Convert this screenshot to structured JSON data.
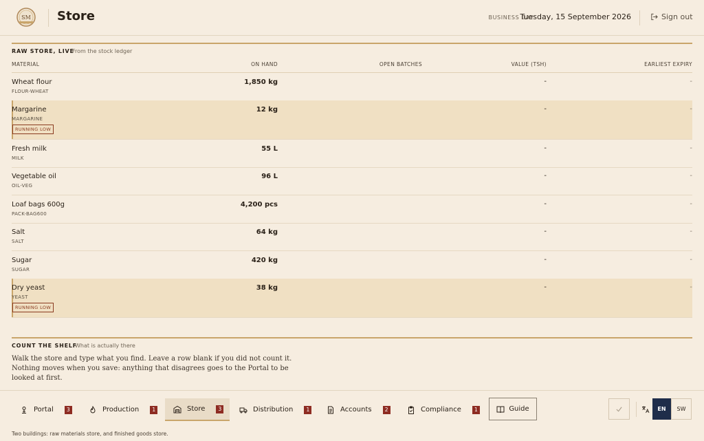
{
  "header": {
    "logo_text": "SM",
    "title": "Store",
    "business_day_label": "BUSINESS DAY",
    "business_day_value": "Tuesday, 15 September 2026",
    "sign_out_label": "Sign out"
  },
  "raw_store": {
    "label": "RAW STORE, LIVE",
    "sub": "From the stock ledger",
    "columns": [
      "MATERIAL",
      "ON HAND",
      "OPEN BATCHES",
      "VALUE (TSH)",
      "EARLIEST EXPIRY"
    ],
    "rows": [
      {
        "name": "Wheat flour",
        "code": "FLOUR-WHEAT",
        "on_hand": "1,850 kg",
        "value": "-",
        "expiry": "-",
        "badge": ""
      },
      {
        "name": "Margarine",
        "code": "MARGARINE",
        "on_hand": "12 kg",
        "value": "-",
        "expiry": "-",
        "badge": "RUNNING LOW"
      },
      {
        "name": "Fresh milk",
        "code": "MILK",
        "on_hand": "55 L",
        "value": "-",
        "expiry": "-",
        "badge": ""
      },
      {
        "name": "Vegetable oil",
        "code": "OIL-VEG",
        "on_hand": "96 L",
        "value": "-",
        "expiry": "-",
        "badge": ""
      },
      {
        "name": "Loaf bags 600g",
        "code": "PACK-BAG600",
        "on_hand": "4,200 pcs",
        "value": "-",
        "expiry": "-",
        "badge": ""
      },
      {
        "name": "Salt",
        "code": "SALT",
        "on_hand": "64 kg",
        "value": "-",
        "expiry": "-",
        "badge": ""
      },
      {
        "name": "Sugar",
        "code": "SUGAR",
        "on_hand": "420 kg",
        "value": "-",
        "expiry": "-",
        "badge": ""
      },
      {
        "name": "Dry yeast",
        "code": "YEAST",
        "on_hand": "38 kg",
        "value": "-",
        "expiry": "-",
        "badge": "RUNNING LOW"
      }
    ]
  },
  "count_shelf": {
    "label": "COUNT THE SHELF",
    "sub": "What is actually there",
    "text": "Walk the store and type what you find. Leave a row blank if you did not count it. Nothing moves when you save: anything that disagrees goes to the Portal to be looked at first."
  },
  "nav": {
    "items": [
      {
        "label": "Portal",
        "count": "3",
        "icon": "portal-icon"
      },
      {
        "label": "Production",
        "count": "1",
        "icon": "flame-icon"
      },
      {
        "label": "Store",
        "count": "3",
        "icon": "warehouse-icon"
      },
      {
        "label": "Distribution",
        "count": "1",
        "icon": "truck-icon"
      },
      {
        "label": "Accounts",
        "count": "2",
        "icon": "document-icon"
      },
      {
        "label": "Compliance",
        "count": "1",
        "icon": "clipboard-check-icon"
      }
    ],
    "active": "Store",
    "guide_label": "Guide",
    "lang_en": "EN",
    "lang_sw": "SW",
    "footnote": "Two buildings: raw materials store, and finished goods store."
  },
  "colors": {
    "background": "#f6ede0",
    "accent_gold": "#c9a56a",
    "badge_red": "#8e2c22",
    "lang_active": "#1f2d4a",
    "low_row": "#f0e0c3"
  }
}
